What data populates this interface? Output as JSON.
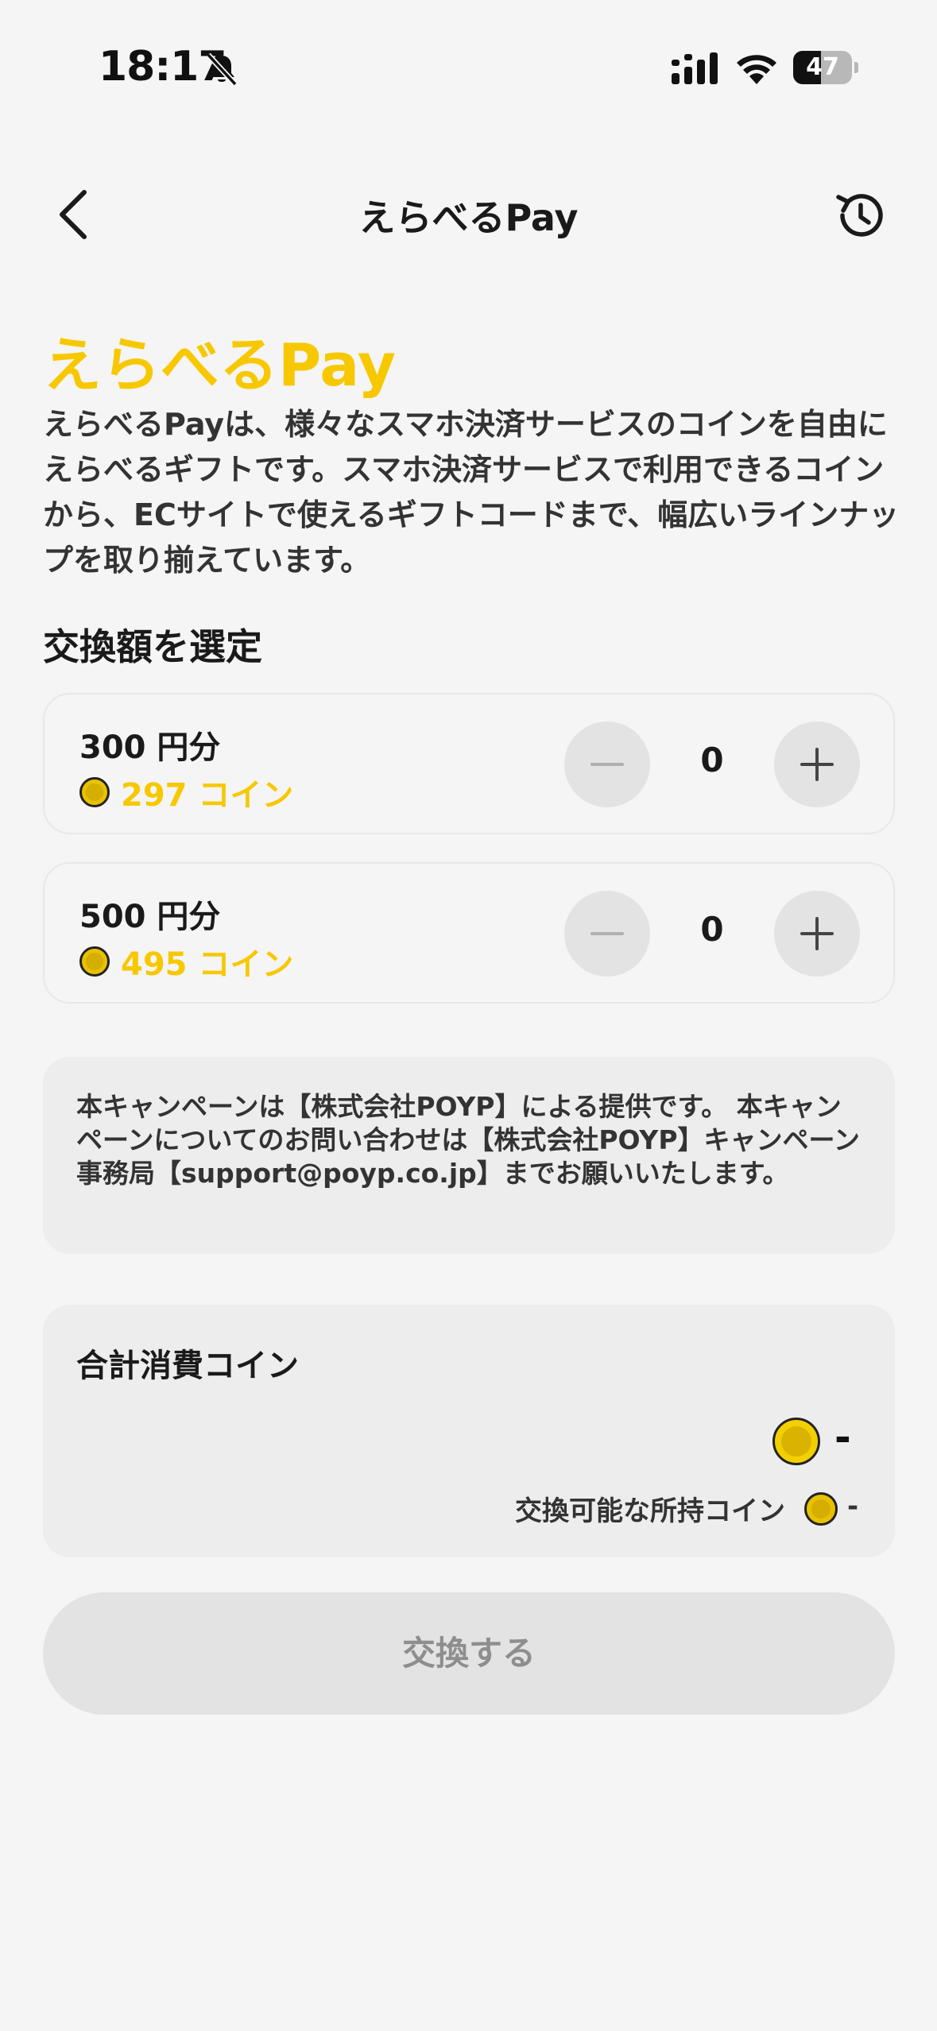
{
  "status_bar": {
    "time": "18:17",
    "battery": "47",
    "battery_level": 0.47
  },
  "header": {
    "title": "えらべるPay"
  },
  "intro": {
    "title": "えらべるPay",
    "description": "えらべるPayは、様々なスマホ決済サービスのコインを自由にえらべるギフトです。スマホ決済サービスで利用できるコインから、ECサイトで使えるギフトコードまで、幅広いラインナップを取り揃えています。"
  },
  "section_title": "交換額を選定",
  "products": [
    {
      "name": "300 円分",
      "price": "297 コイン",
      "quantity": "0"
    },
    {
      "name": "500 円分",
      "price": "495 コイン",
      "quantity": "0"
    }
  ],
  "notice": "本キャンペーンは【株式会社POYP】による提供です。 本キャンペーンについてのお問い合わせは【株式会社POYP】キャンペーン事務局【support@poyp.co.jp】までお願いいたします。",
  "total": {
    "title": "合計消費コイン",
    "value": "-",
    "owned_label": "交換可能な所持コイン",
    "owned_value": "-"
  },
  "exchange_button": "交換する",
  "icons": {
    "bell": "bell-slash-icon",
    "signal": "cellular-signal-icon",
    "wifi": "wifi-icon",
    "back": "chevron-left-icon",
    "history": "history-icon",
    "coin": "coin-icon",
    "minus": "minus-icon",
    "plus": "plus-icon"
  },
  "colors": {
    "accent": "#f7c800",
    "background": "#f5f5f5",
    "panel": "#ededed",
    "button_disabled": "#e3e3e3"
  }
}
